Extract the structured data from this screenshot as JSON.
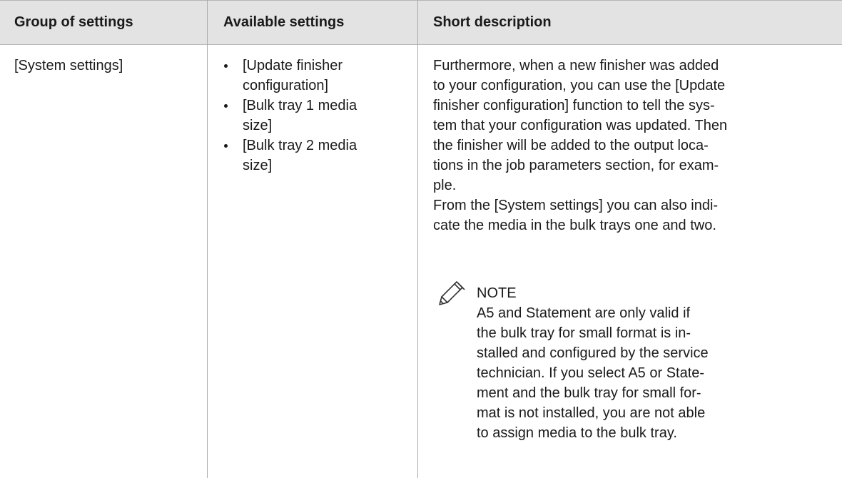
{
  "table": {
    "headers": [
      "Group of settings",
      "Available settings",
      "Short description"
    ],
    "row": {
      "group": "[System settings]",
      "available": [
        [
          "[Update finisher",
          "configuration]"
        ],
        [
          "[Bulk tray 1 media",
          "size]"
        ],
        [
          "[Bulk tray 2 media",
          "size]"
        ]
      ],
      "description_lines": [
        "Furthermore, when a new finisher was added",
        "to your configuration, you can use the [Update",
        "finisher configuration] function to tell the sys-",
        "tem that your configuration was updated. Then",
        "the finisher will be added to the output loca-",
        "tions in the job parameters section, for exam-",
        "ple.",
        "From the [System settings] you can also indi-",
        "cate the media in the bulk trays one and two."
      ],
      "note": {
        "icon": "pencil-note-icon",
        "title": "NOTE",
        "lines": [
          "A5 and Statement are only valid if",
          "the bulk tray for small format is in-",
          "stalled and configured by the service",
          "technician. If you select A5 or State-",
          "ment and the bulk tray for small for-",
          "mat is not installed, you are not able",
          "to assign media to the bulk tray."
        ]
      }
    }
  },
  "colors": {
    "header_bg": "#e3e3e3",
    "rule": "#a9a9a9",
    "text": "#1a1a1a"
  }
}
